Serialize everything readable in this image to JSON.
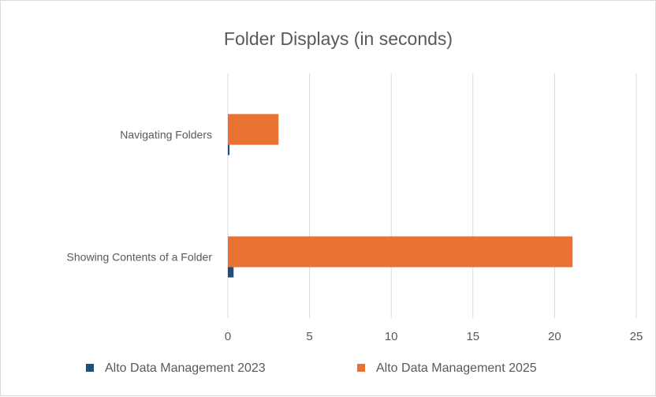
{
  "chart_data": {
    "type": "bar",
    "orientation": "horizontal",
    "title": "Folder Displays (in seconds)",
    "xlabel": "",
    "ylabel": "",
    "categories": [
      "Navigating Folders",
      "Showing Contents of a Folder"
    ],
    "series": [
      {
        "name": "Alto Data Management 2023",
        "values": [
          0.1,
          0.35
        ],
        "color": "#1f4e79"
      },
      {
        "name": "Alto Data Management 2025",
        "values": [
          3.1,
          21.1
        ],
        "color": "#e97132"
      }
    ],
    "xlim": [
      0,
      25
    ],
    "xticks": [
      "0",
      "5",
      "10",
      "15",
      "20",
      "25"
    ],
    "grid": true,
    "legend_position": "bottom"
  }
}
